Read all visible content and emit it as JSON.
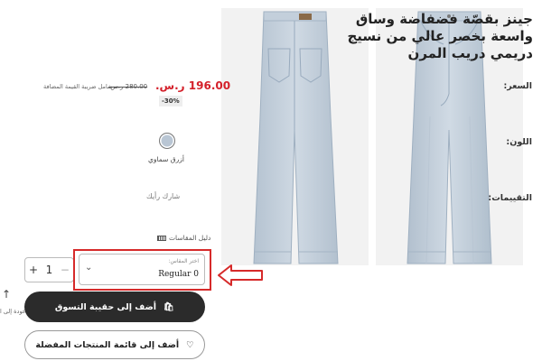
{
  "product": {
    "title": "جينز بقصّة فضفاضة وساق واسعة بخصر عالي من نسيج دريمي دريب المرن"
  },
  "price": {
    "label": "السعر:",
    "current": "196.00 ر.س.",
    "original": "280.00 ر.س.",
    "note": "شامل ضريبة القيمة المضافة",
    "discount": "-30%"
  },
  "color": {
    "label": "اللون:",
    "selected": "أزرق سماوي",
    "hex": "#b9c6d4"
  },
  "ratings": {
    "label": "التقييمات:",
    "share": "شارك رأيك"
  },
  "size_guide": {
    "label": "دليل المقاسات",
    "icon": "ruler-icon"
  },
  "quantity": {
    "plus": "+",
    "value": "1",
    "minus": "−"
  },
  "size": {
    "label": "اختر المقاس:",
    "value": "Regular 0",
    "icon": "chevron-down-icon"
  },
  "buttons": {
    "add_to_bag": "أضف إلى حقيبة التسوق",
    "add_to_wishlist": "أضف إلى قائمة المنتجات المفضلة"
  },
  "back_to_top": {
    "label": "عودة إلى ا"
  },
  "colors": {
    "primary_button": "#2b2b2b",
    "sale_price": "#d4202a",
    "annotation": "#d62a2a"
  }
}
